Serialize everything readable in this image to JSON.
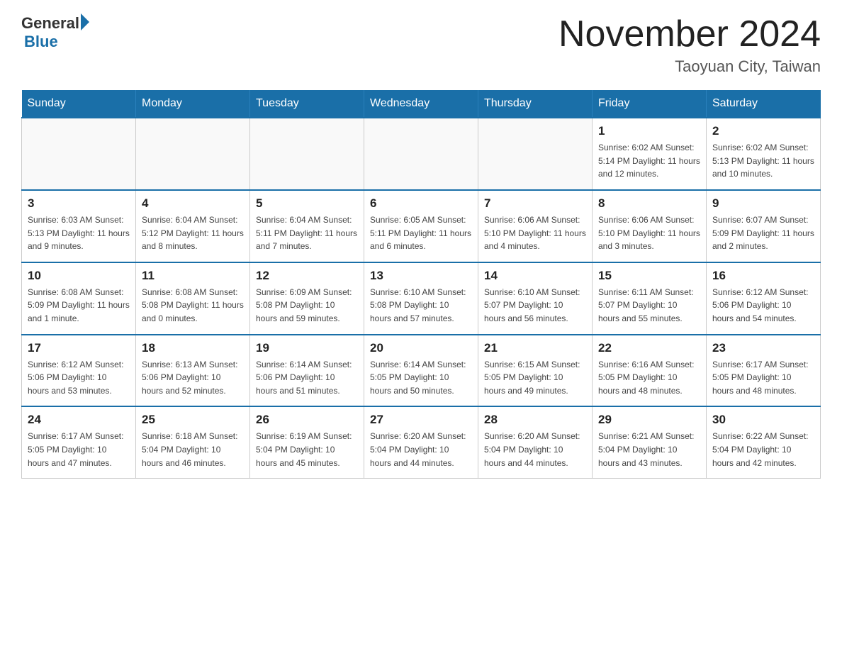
{
  "header": {
    "logo_general": "General",
    "logo_blue": "Blue",
    "month_year": "November 2024",
    "location": "Taoyuan City, Taiwan"
  },
  "weekdays": [
    "Sunday",
    "Monday",
    "Tuesday",
    "Wednesday",
    "Thursday",
    "Friday",
    "Saturday"
  ],
  "rows": [
    {
      "days": [
        {
          "num": "",
          "info": ""
        },
        {
          "num": "",
          "info": ""
        },
        {
          "num": "",
          "info": ""
        },
        {
          "num": "",
          "info": ""
        },
        {
          "num": "",
          "info": ""
        },
        {
          "num": "1",
          "info": "Sunrise: 6:02 AM\nSunset: 5:14 PM\nDaylight: 11 hours\nand 12 minutes."
        },
        {
          "num": "2",
          "info": "Sunrise: 6:02 AM\nSunset: 5:13 PM\nDaylight: 11 hours\nand 10 minutes."
        }
      ]
    },
    {
      "days": [
        {
          "num": "3",
          "info": "Sunrise: 6:03 AM\nSunset: 5:13 PM\nDaylight: 11 hours\nand 9 minutes."
        },
        {
          "num": "4",
          "info": "Sunrise: 6:04 AM\nSunset: 5:12 PM\nDaylight: 11 hours\nand 8 minutes."
        },
        {
          "num": "5",
          "info": "Sunrise: 6:04 AM\nSunset: 5:11 PM\nDaylight: 11 hours\nand 7 minutes."
        },
        {
          "num": "6",
          "info": "Sunrise: 6:05 AM\nSunset: 5:11 PM\nDaylight: 11 hours\nand 6 minutes."
        },
        {
          "num": "7",
          "info": "Sunrise: 6:06 AM\nSunset: 5:10 PM\nDaylight: 11 hours\nand 4 minutes."
        },
        {
          "num": "8",
          "info": "Sunrise: 6:06 AM\nSunset: 5:10 PM\nDaylight: 11 hours\nand 3 minutes."
        },
        {
          "num": "9",
          "info": "Sunrise: 6:07 AM\nSunset: 5:09 PM\nDaylight: 11 hours\nand 2 minutes."
        }
      ]
    },
    {
      "days": [
        {
          "num": "10",
          "info": "Sunrise: 6:08 AM\nSunset: 5:09 PM\nDaylight: 11 hours\nand 1 minute."
        },
        {
          "num": "11",
          "info": "Sunrise: 6:08 AM\nSunset: 5:08 PM\nDaylight: 11 hours\nand 0 minutes."
        },
        {
          "num": "12",
          "info": "Sunrise: 6:09 AM\nSunset: 5:08 PM\nDaylight: 10 hours\nand 59 minutes."
        },
        {
          "num": "13",
          "info": "Sunrise: 6:10 AM\nSunset: 5:08 PM\nDaylight: 10 hours\nand 57 minutes."
        },
        {
          "num": "14",
          "info": "Sunrise: 6:10 AM\nSunset: 5:07 PM\nDaylight: 10 hours\nand 56 minutes."
        },
        {
          "num": "15",
          "info": "Sunrise: 6:11 AM\nSunset: 5:07 PM\nDaylight: 10 hours\nand 55 minutes."
        },
        {
          "num": "16",
          "info": "Sunrise: 6:12 AM\nSunset: 5:06 PM\nDaylight: 10 hours\nand 54 minutes."
        }
      ]
    },
    {
      "days": [
        {
          "num": "17",
          "info": "Sunrise: 6:12 AM\nSunset: 5:06 PM\nDaylight: 10 hours\nand 53 minutes."
        },
        {
          "num": "18",
          "info": "Sunrise: 6:13 AM\nSunset: 5:06 PM\nDaylight: 10 hours\nand 52 minutes."
        },
        {
          "num": "19",
          "info": "Sunrise: 6:14 AM\nSunset: 5:06 PM\nDaylight: 10 hours\nand 51 minutes."
        },
        {
          "num": "20",
          "info": "Sunrise: 6:14 AM\nSunset: 5:05 PM\nDaylight: 10 hours\nand 50 minutes."
        },
        {
          "num": "21",
          "info": "Sunrise: 6:15 AM\nSunset: 5:05 PM\nDaylight: 10 hours\nand 49 minutes."
        },
        {
          "num": "22",
          "info": "Sunrise: 6:16 AM\nSunset: 5:05 PM\nDaylight: 10 hours\nand 48 minutes."
        },
        {
          "num": "23",
          "info": "Sunrise: 6:17 AM\nSunset: 5:05 PM\nDaylight: 10 hours\nand 48 minutes."
        }
      ]
    },
    {
      "days": [
        {
          "num": "24",
          "info": "Sunrise: 6:17 AM\nSunset: 5:05 PM\nDaylight: 10 hours\nand 47 minutes."
        },
        {
          "num": "25",
          "info": "Sunrise: 6:18 AM\nSunset: 5:04 PM\nDaylight: 10 hours\nand 46 minutes."
        },
        {
          "num": "26",
          "info": "Sunrise: 6:19 AM\nSunset: 5:04 PM\nDaylight: 10 hours\nand 45 minutes."
        },
        {
          "num": "27",
          "info": "Sunrise: 6:20 AM\nSunset: 5:04 PM\nDaylight: 10 hours\nand 44 minutes."
        },
        {
          "num": "28",
          "info": "Sunrise: 6:20 AM\nSunset: 5:04 PM\nDaylight: 10 hours\nand 44 minutes."
        },
        {
          "num": "29",
          "info": "Sunrise: 6:21 AM\nSunset: 5:04 PM\nDaylight: 10 hours\nand 43 minutes."
        },
        {
          "num": "30",
          "info": "Sunrise: 6:22 AM\nSunset: 5:04 PM\nDaylight: 10 hours\nand 42 minutes."
        }
      ]
    }
  ]
}
